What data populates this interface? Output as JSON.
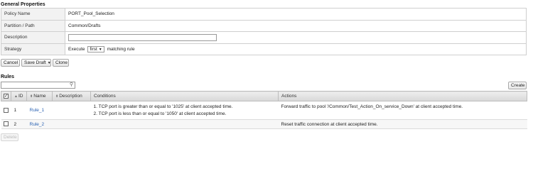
{
  "general": {
    "title": "General Properties",
    "policy_name_label": "Policy Name",
    "policy_name_value": "PORT_Pool_Selection",
    "partition_label": "Partition / Path",
    "partition_value": "Common/Drafts",
    "description_label": "Description",
    "description_value": "",
    "strategy_label": "Strategy",
    "strategy_prefix": "Execute",
    "strategy_selected": "first",
    "strategy_suffix": "matching rule"
  },
  "actions_bar": {
    "cancel": "Cancel",
    "save_draft": "Save Draft",
    "clone": "Clone"
  },
  "rules": {
    "title": "Rules",
    "search_value": "",
    "create": "Create",
    "delete": "Delete",
    "columns": {
      "id": "ID",
      "name": "Name",
      "description": "Description",
      "conditions": "Conditions",
      "actions": "Actions"
    },
    "rows": [
      {
        "id": "1",
        "name": "Rule_1",
        "description": "",
        "conditions": [
          "1. TCP port is greater than or equal to '1025' at client accepted time.",
          "2. TCP port is less than or equal to '1050' at client accepted time."
        ],
        "action": "Forward traffic to pool '/Common/Test_Action_On_service_Down' at client accepted time."
      },
      {
        "id": "2",
        "name": "Rule_2",
        "description": "",
        "conditions": [],
        "action": "Reset traffic connection at client accepted time."
      }
    ]
  },
  "icons": {
    "search": "search-icon",
    "sort_up": "sort-up-icon",
    "sort_both": "sort-icon",
    "dropdown": "chevron-down-icon",
    "checkbox": "checkbox-icon"
  }
}
